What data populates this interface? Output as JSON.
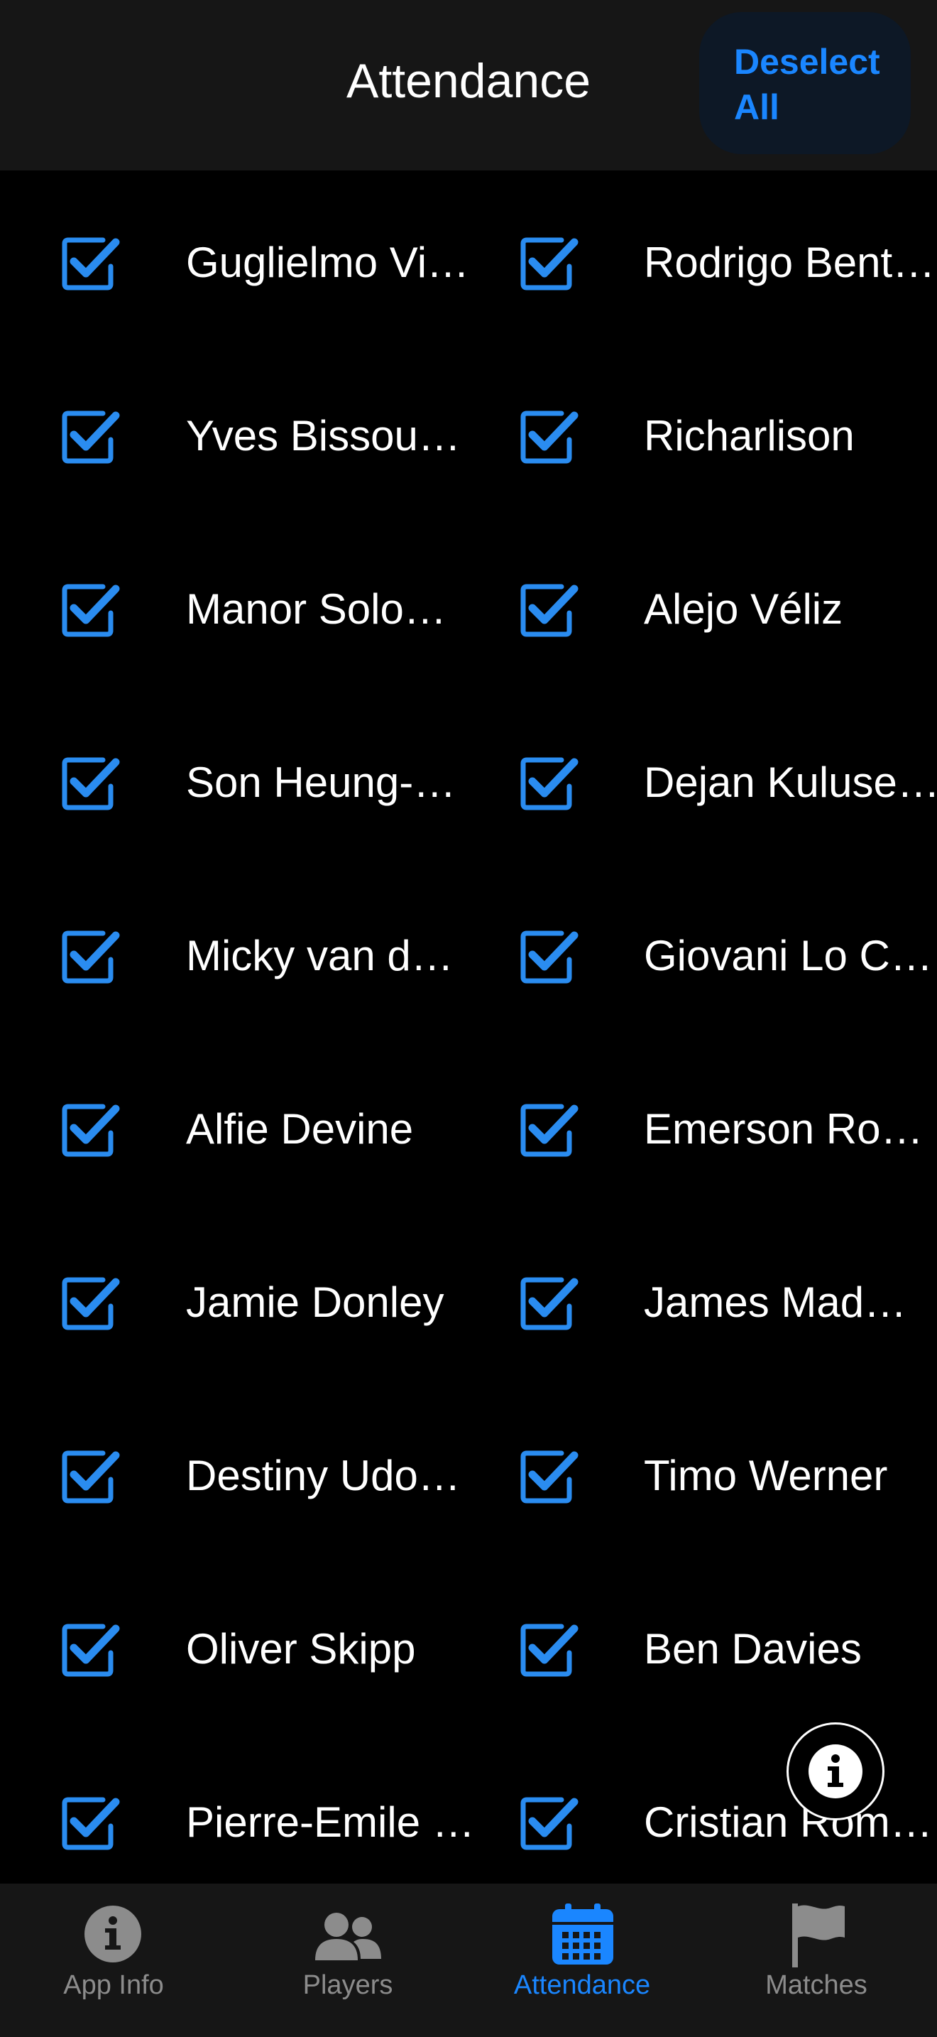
{
  "header": {
    "title": "Attendance",
    "deselect_label": "Deselect All"
  },
  "attendance": {
    "rows": [
      {
        "left": {
          "name": "Guglielmo Vi…",
          "checked": true
        },
        "right": {
          "name": "Rodrigo Bent…",
          "checked": true
        }
      },
      {
        "left": {
          "name": "Yves Bissou…",
          "checked": true
        },
        "right": {
          "name": "Richarlison",
          "checked": true
        }
      },
      {
        "left": {
          "name": "Manor Solo…",
          "checked": true
        },
        "right": {
          "name": "Alejo Véliz",
          "checked": true
        }
      },
      {
        "left": {
          "name": "Son Heung-…",
          "checked": true
        },
        "right": {
          "name": "Dejan Kuluse…",
          "checked": true
        }
      },
      {
        "left": {
          "name": "Micky van d…",
          "checked": true
        },
        "right": {
          "name": "Giovani Lo C…",
          "checked": true
        }
      },
      {
        "left": {
          "name": "Alfie Devine",
          "checked": true
        },
        "right": {
          "name": "Emerson Ro…",
          "checked": true
        }
      },
      {
        "left": {
          "name": "Jamie Donley",
          "checked": true
        },
        "right": {
          "name": "James Mad…",
          "checked": true
        }
      },
      {
        "left": {
          "name": "Destiny Udo…",
          "checked": true
        },
        "right": {
          "name": "Timo Werner",
          "checked": true
        }
      },
      {
        "left": {
          "name": "Oliver Skipp",
          "checked": true
        },
        "right": {
          "name": "Ben Davies",
          "checked": true
        }
      },
      {
        "left": {
          "name": "Pierre-Emile …",
          "checked": true
        },
        "right": {
          "name": "Cristian Rom…",
          "checked": true
        }
      }
    ]
  },
  "fab": {
    "icon": "info-icon"
  },
  "tabs": [
    {
      "label": "App Info",
      "icon": "info-circle-icon",
      "active": false
    },
    {
      "label": "Players",
      "icon": "players-icon",
      "active": false
    },
    {
      "label": "Attendance",
      "icon": "calendar-icon",
      "active": true
    },
    {
      "label": "Matches",
      "icon": "flag-icon",
      "active": false
    }
  ],
  "colors": {
    "accent": "#1a86ff",
    "checkbox": "#2a8cf0",
    "header_bg": "#161616",
    "background": "#000000",
    "inactive": "#8c8c8c"
  }
}
